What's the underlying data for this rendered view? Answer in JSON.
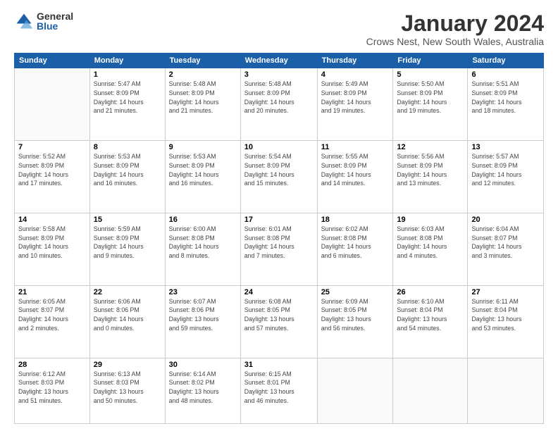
{
  "logo": {
    "general": "General",
    "blue": "Blue"
  },
  "title": "January 2024",
  "subtitle": "Crows Nest, New South Wales, Australia",
  "headers": [
    "Sunday",
    "Monday",
    "Tuesday",
    "Wednesday",
    "Thursday",
    "Friday",
    "Saturday"
  ],
  "weeks": [
    [
      {
        "day": "",
        "info": ""
      },
      {
        "day": "1",
        "info": "Sunrise: 5:47 AM\nSunset: 8:09 PM\nDaylight: 14 hours\nand 21 minutes."
      },
      {
        "day": "2",
        "info": "Sunrise: 5:48 AM\nSunset: 8:09 PM\nDaylight: 14 hours\nand 21 minutes."
      },
      {
        "day": "3",
        "info": "Sunrise: 5:48 AM\nSunset: 8:09 PM\nDaylight: 14 hours\nand 20 minutes."
      },
      {
        "day": "4",
        "info": "Sunrise: 5:49 AM\nSunset: 8:09 PM\nDaylight: 14 hours\nand 19 minutes."
      },
      {
        "day": "5",
        "info": "Sunrise: 5:50 AM\nSunset: 8:09 PM\nDaylight: 14 hours\nand 19 minutes."
      },
      {
        "day": "6",
        "info": "Sunrise: 5:51 AM\nSunset: 8:09 PM\nDaylight: 14 hours\nand 18 minutes."
      }
    ],
    [
      {
        "day": "7",
        "info": "Sunrise: 5:52 AM\nSunset: 8:09 PM\nDaylight: 14 hours\nand 17 minutes."
      },
      {
        "day": "8",
        "info": "Sunrise: 5:53 AM\nSunset: 8:09 PM\nDaylight: 14 hours\nand 16 minutes."
      },
      {
        "day": "9",
        "info": "Sunrise: 5:53 AM\nSunset: 8:09 PM\nDaylight: 14 hours\nand 16 minutes."
      },
      {
        "day": "10",
        "info": "Sunrise: 5:54 AM\nSunset: 8:09 PM\nDaylight: 14 hours\nand 15 minutes."
      },
      {
        "day": "11",
        "info": "Sunrise: 5:55 AM\nSunset: 8:09 PM\nDaylight: 14 hours\nand 14 minutes."
      },
      {
        "day": "12",
        "info": "Sunrise: 5:56 AM\nSunset: 8:09 PM\nDaylight: 14 hours\nand 13 minutes."
      },
      {
        "day": "13",
        "info": "Sunrise: 5:57 AM\nSunset: 8:09 PM\nDaylight: 14 hours\nand 12 minutes."
      }
    ],
    [
      {
        "day": "14",
        "info": "Sunrise: 5:58 AM\nSunset: 8:09 PM\nDaylight: 14 hours\nand 10 minutes."
      },
      {
        "day": "15",
        "info": "Sunrise: 5:59 AM\nSunset: 8:09 PM\nDaylight: 14 hours\nand 9 minutes."
      },
      {
        "day": "16",
        "info": "Sunrise: 6:00 AM\nSunset: 8:08 PM\nDaylight: 14 hours\nand 8 minutes."
      },
      {
        "day": "17",
        "info": "Sunrise: 6:01 AM\nSunset: 8:08 PM\nDaylight: 14 hours\nand 7 minutes."
      },
      {
        "day": "18",
        "info": "Sunrise: 6:02 AM\nSunset: 8:08 PM\nDaylight: 14 hours\nand 6 minutes."
      },
      {
        "day": "19",
        "info": "Sunrise: 6:03 AM\nSunset: 8:08 PM\nDaylight: 14 hours\nand 4 minutes."
      },
      {
        "day": "20",
        "info": "Sunrise: 6:04 AM\nSunset: 8:07 PM\nDaylight: 14 hours\nand 3 minutes."
      }
    ],
    [
      {
        "day": "21",
        "info": "Sunrise: 6:05 AM\nSunset: 8:07 PM\nDaylight: 14 hours\nand 2 minutes."
      },
      {
        "day": "22",
        "info": "Sunrise: 6:06 AM\nSunset: 8:06 PM\nDaylight: 14 hours\nand 0 minutes."
      },
      {
        "day": "23",
        "info": "Sunrise: 6:07 AM\nSunset: 8:06 PM\nDaylight: 13 hours\nand 59 minutes."
      },
      {
        "day": "24",
        "info": "Sunrise: 6:08 AM\nSunset: 8:05 PM\nDaylight: 13 hours\nand 57 minutes."
      },
      {
        "day": "25",
        "info": "Sunrise: 6:09 AM\nSunset: 8:05 PM\nDaylight: 13 hours\nand 56 minutes."
      },
      {
        "day": "26",
        "info": "Sunrise: 6:10 AM\nSunset: 8:04 PM\nDaylight: 13 hours\nand 54 minutes."
      },
      {
        "day": "27",
        "info": "Sunrise: 6:11 AM\nSunset: 8:04 PM\nDaylight: 13 hours\nand 53 minutes."
      }
    ],
    [
      {
        "day": "28",
        "info": "Sunrise: 6:12 AM\nSunset: 8:03 PM\nDaylight: 13 hours\nand 51 minutes."
      },
      {
        "day": "29",
        "info": "Sunrise: 6:13 AM\nSunset: 8:03 PM\nDaylight: 13 hours\nand 50 minutes."
      },
      {
        "day": "30",
        "info": "Sunrise: 6:14 AM\nSunset: 8:02 PM\nDaylight: 13 hours\nand 48 minutes."
      },
      {
        "day": "31",
        "info": "Sunrise: 6:15 AM\nSunset: 8:01 PM\nDaylight: 13 hours\nand 46 minutes."
      },
      {
        "day": "",
        "info": ""
      },
      {
        "day": "",
        "info": ""
      },
      {
        "day": "",
        "info": ""
      }
    ]
  ]
}
